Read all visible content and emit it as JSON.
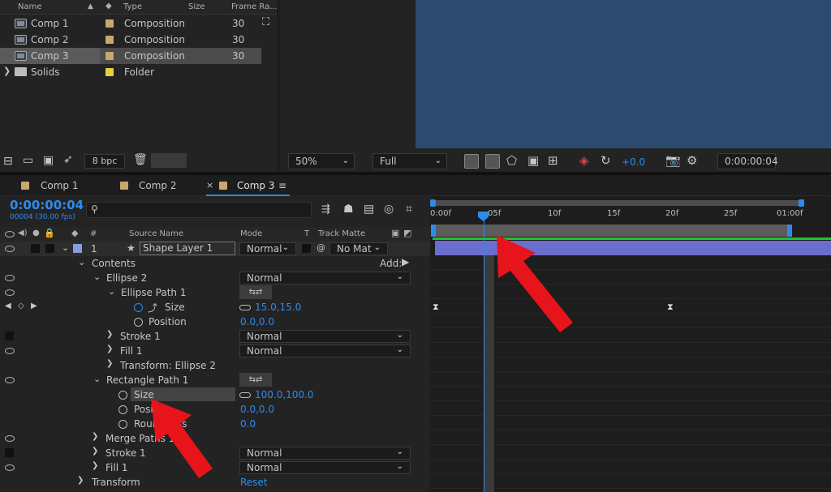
{
  "project": {
    "columns": [
      "Name",
      "Type",
      "Size",
      "Frame Ra..."
    ],
    "items": [
      {
        "name": "Comp 1",
        "type": "Composition",
        "fps": "30",
        "swatch": "#c9a86c"
      },
      {
        "name": "Comp 2",
        "type": "Composition",
        "fps": "30",
        "swatch": "#c9a86c"
      },
      {
        "name": "Comp 3",
        "type": "Composition",
        "fps": "30",
        "swatch": "#c9a86c"
      },
      {
        "name": "Solids",
        "type": "Folder",
        "fps": "",
        "swatch": "#e8d03c"
      }
    ],
    "bpc": "8 bpc"
  },
  "viewer": {
    "zoom": "50%",
    "resolution": "Full",
    "exposure": "+0.0",
    "timecode": "0:00:00:04"
  },
  "tabs": [
    {
      "label": "Comp 1"
    },
    {
      "label": "Comp 2"
    },
    {
      "label": "Comp 3"
    }
  ],
  "timeline": {
    "timecode": "0:00:00:04",
    "frames": "00004 (30.00 fps)",
    "columns": {
      "number": "#",
      "source": "Source Name",
      "mode": "Mode",
      "t": "T",
      "matte": "Track Matte"
    },
    "ruler": [
      "0:00f",
      "05f",
      "10f",
      "15f",
      "20f",
      "25f",
      "01:00f"
    ]
  },
  "layer": {
    "number": "1",
    "name": "Shape Layer 1",
    "mode": "Normal",
    "matte": "No Mat"
  },
  "tree": {
    "contents": "Contents",
    "add": "Add:",
    "ellipse2": "Ellipse 2",
    "ellipse2_mode": "Normal",
    "ellipse_path": "Ellipse Path 1",
    "size_label": "Size",
    "ellipse_size": "15.0,15.0",
    "position_label": "Position",
    "ellipse_position": "0.0,0.0",
    "stroke1": "Stroke 1",
    "stroke1_mode": "Normal",
    "fill1": "Fill 1",
    "fill1_mode": "Normal",
    "transform_ellipse": "Transform: Ellipse 2",
    "rect_path": "Rectangle Path 1",
    "rect_size_label": "Size",
    "rect_size": "100.0,100.0",
    "rect_position_label": "Position",
    "rect_position": "0.0,0.0",
    "roundness_label": "Roundness",
    "roundness": "0.0",
    "merge": "Merge Paths 1",
    "stroke1b": "Stroke 1",
    "stroke1b_mode": "Normal",
    "fill1b": "Fill 1",
    "fill1b_mode": "Normal",
    "transform": "Transform",
    "reset": "Reset"
  },
  "colors": {
    "accent": "#2d8ceb",
    "comp_bg": "#2c4a6d",
    "arrow": "#e8141b",
    "work_green": "#22c22e",
    "layer_bar": "#6a6fcf"
  }
}
